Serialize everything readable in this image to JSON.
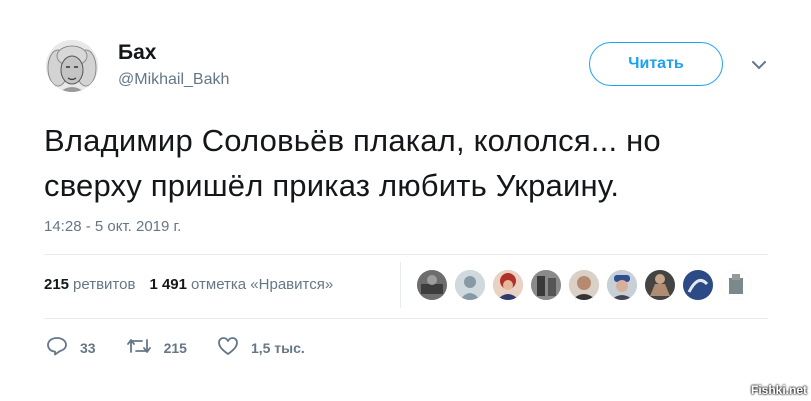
{
  "author": {
    "name": "Бах",
    "handle": "@Mikhail_Bakh"
  },
  "follow": {
    "label": "Читать"
  },
  "tweet": {
    "text_line1": "Владимир Соловьёв плакал, кололся... но",
    "text_line2": "сверху пришёл приказ любить Украину.",
    "timestamp": "14:28 - 5 окт. 2019 г."
  },
  "stats": {
    "retweets_count": "215",
    "retweets_label": "ретвитов",
    "likes_count": "1 491",
    "likes_label": "отметка «Нравится»"
  },
  "actions": {
    "replies": "33",
    "retweets": "215",
    "likes": "1,5 тыс."
  },
  "icons": {
    "reply": "reply-icon",
    "retweet": "retweet-icon",
    "like": "heart-icon",
    "caret": "chevron-down-icon"
  },
  "colors": {
    "accent": "#1da1f2",
    "secondary_text": "#657786",
    "divider": "#e6ecf0"
  },
  "watermark": "Fishki.net"
}
